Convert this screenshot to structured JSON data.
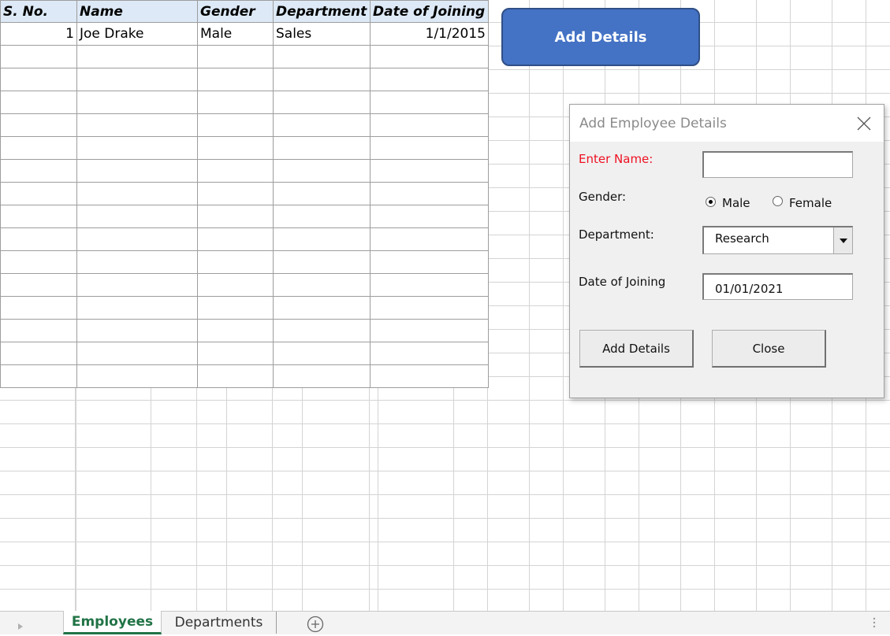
{
  "table": {
    "headers": [
      "S. No.",
      "Name",
      "Gender",
      "Department",
      "Date of Joining"
    ],
    "rows": [
      {
        "sno": "1",
        "name": "Joe Drake",
        "gender": "Male",
        "department": "Sales",
        "doj": "1/1/2015"
      }
    ]
  },
  "sheet_button": {
    "label": "Add Details",
    "color": "#4472c4"
  },
  "dialog": {
    "title": "Add Employee Details",
    "name_label": "Enter Name:",
    "name_value": "",
    "gender_label": "Gender:",
    "gender_options": [
      "Male",
      "Female"
    ],
    "gender_selected": "Male",
    "department_label": "Department:",
    "department_value": "Research",
    "doj_label": "Date of Joining",
    "doj_value": "01/01/2021",
    "add_button": "Add Details",
    "close_button": "Close"
  },
  "tabs": {
    "items": [
      "Employees",
      "Departments"
    ],
    "active": "Employees",
    "active_color": "#217346"
  },
  "icons": {
    "close": "close-x-icon",
    "dropdown": "chevron-down-icon",
    "add_sheet": "plus-circle-icon",
    "scroll_left": "triangle-left-icon",
    "options": "vertical-dots-icon"
  }
}
